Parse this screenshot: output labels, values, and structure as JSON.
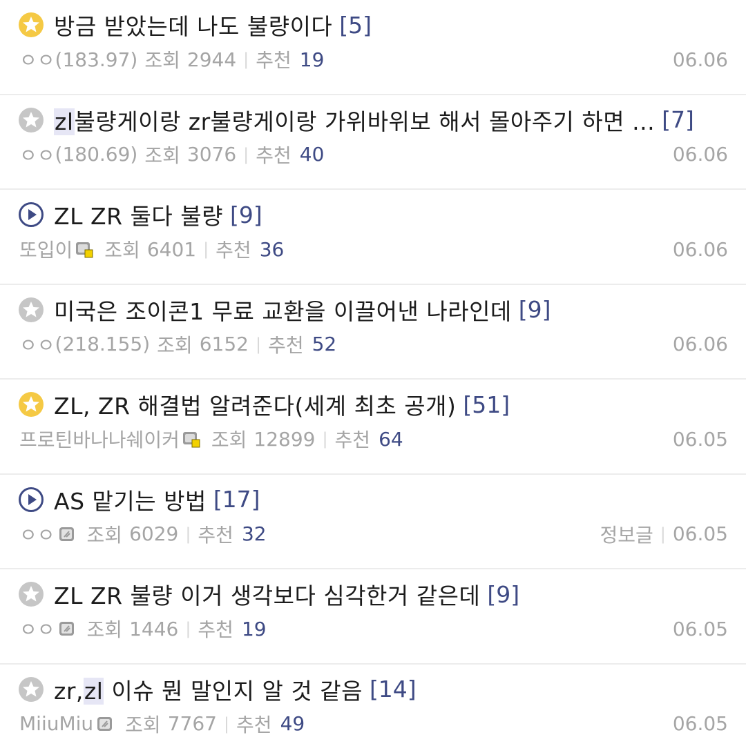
{
  "labels": {
    "views": "조회",
    "recommend": "추천"
  },
  "posts": [
    {
      "icon": "star-yellow-icon",
      "title_parts": [
        "방금 받았는데 나도 불량이다"
      ],
      "comments": "[5]",
      "author": "ㅇㅇ",
      "ip": "(183.97)",
      "member_badge": "",
      "views": "2944",
      "recommend": "19",
      "tag": "",
      "date": "06.06"
    },
    {
      "icon": "star-gray-icon",
      "title_pre": "",
      "title_mark": "zl",
      "title_post": "불량게이랑 zr불량게이랑 가위바위보 해서 몰아주기 하면 ...",
      "comments": "[7]",
      "author": "ㅇㅇ",
      "ip": "(180.69)",
      "views": "3076",
      "recommend": "40",
      "tag": "",
      "date": "06.06"
    },
    {
      "icon": "play-circle-icon",
      "title": "ZL ZR 둘다 불량",
      "comments": "[9]",
      "author": "또입이",
      "member_badge": "semi-fixed-nick-icon",
      "views": "6401",
      "recommend": "36",
      "tag": "",
      "date": "06.06"
    },
    {
      "icon": "star-gray-icon",
      "title": "미국은 조이콘1 무료 교환을 이끌어낸 나라인데",
      "comments": "[9]",
      "author": "ㅇㅇ",
      "ip": "(218.155)",
      "views": "6152",
      "recommend": "52",
      "tag": "",
      "date": "06.06"
    },
    {
      "icon": "star-yellow-icon",
      "title": "ZL, ZR 해결법 알려준다(세계 최초 공개)",
      "comments": "[51]",
      "author": "프로틴바나나쉐이커",
      "member_badge": "semi-fixed-nick-icon",
      "views": "12899",
      "recommend": "64",
      "tag": "",
      "date": "06.05"
    },
    {
      "icon": "play-circle-icon",
      "title": "AS 맡기는 방법",
      "comments": "[17]",
      "author": "ㅇㅇ",
      "member_badge": "fixed-nick-icon",
      "views": "6029",
      "recommend": "32",
      "tag": "정보글",
      "date": "06.05"
    },
    {
      "icon": "star-gray-icon",
      "title": "ZL ZR 불량 이거 생각보다 심각한거 같은데",
      "comments": "[9]",
      "author": "ㅇㅇ",
      "member_badge": "fixed-nick-icon",
      "views": "1446",
      "recommend": "19",
      "tag": "",
      "date": "06.05"
    },
    {
      "icon": "star-gray-icon",
      "title_pre": "zr,",
      "title_mark": "zl",
      "title_post": " 이슈 뭔 말인지 알 것 같음",
      "comments": "[14]",
      "author": "MiiuMiu",
      "member_badge": "fixed-nick-icon",
      "views": "7767",
      "recommend": "49",
      "tag": "",
      "date": "06.05"
    }
  ],
  "colors": {
    "star_yellow": "#f5c944",
    "star_gray": "#c6c6c6",
    "play": "#3e4a84",
    "accent": "#3e4a84"
  }
}
